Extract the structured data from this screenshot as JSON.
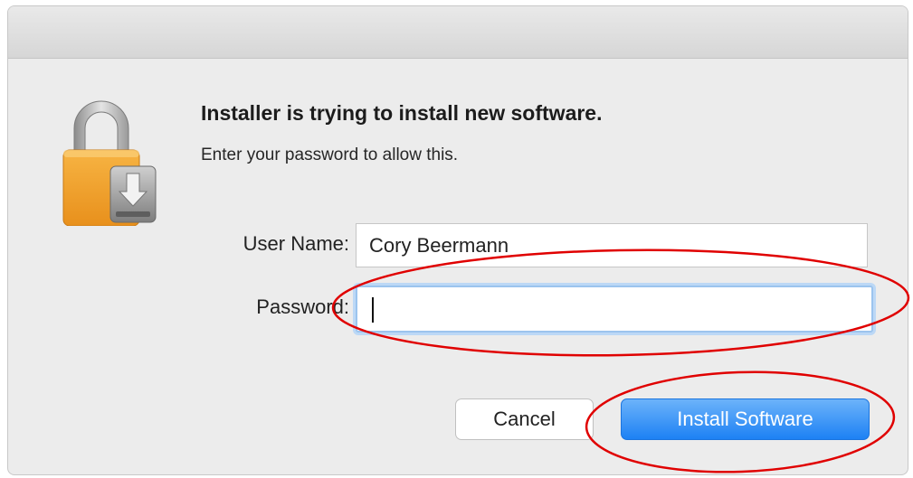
{
  "dialog": {
    "heading": "Installer is trying to install new software.",
    "subtext": "Enter your password to allow this.",
    "icon": "lock-installer-icon"
  },
  "form": {
    "user_label": "User Name:",
    "user_value": "Cory Beermann",
    "password_label": "Password:",
    "password_value": ""
  },
  "buttons": {
    "cancel_label": "Cancel",
    "install_label": "Install Software"
  },
  "colors": {
    "accent": "#1d81f4",
    "annotation": "#e00000",
    "dialog_bg": "#ececec"
  }
}
